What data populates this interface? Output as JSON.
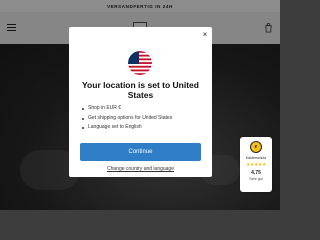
{
  "announcement": {
    "text": "VERSANDFERTIG IN 24H"
  },
  "header": {
    "logo_text": "ONE"
  },
  "modal": {
    "close_symbol": "×",
    "title": "Your location is set to United States",
    "bullets": [
      "Shop in EUR €",
      "Get shipping options for United States",
      "Language set to English"
    ],
    "continue_label": "Continue",
    "change_link_label": "Change country and language"
  },
  "trust_badge": {
    "seal_letter": "e",
    "label": "Käuferschutz",
    "stars": "★★★★★",
    "score": "4,75",
    "rating": "Sehr gut"
  },
  "colors": {
    "button_primary": "#2f7dc6",
    "star": "#f5c21b",
    "seal": "#f5c21b"
  }
}
